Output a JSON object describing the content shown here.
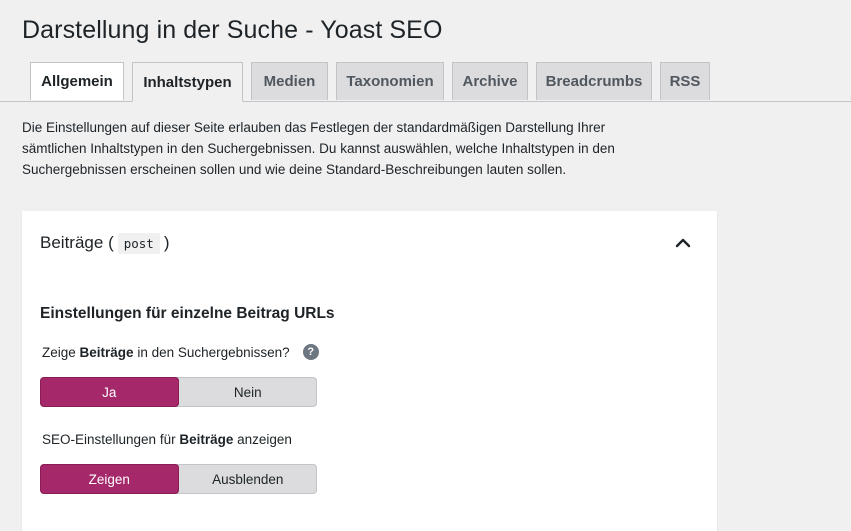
{
  "page": {
    "title": "Darstellung in der Suche - Yoast SEO"
  },
  "tabs": [
    {
      "label": "Allgemein"
    },
    {
      "label": "Inhaltstypen"
    },
    {
      "label": "Medien"
    },
    {
      "label": "Taxonomien"
    },
    {
      "label": "Archive"
    },
    {
      "label": "Breadcrumbs"
    },
    {
      "label": "RSS"
    }
  ],
  "intro": {
    "line1": "Die Einstellungen auf dieser Seite erlauben das Festlegen der standardmäßigen Darstellung Ihrer",
    "line2": "sämtlichen Inhaltstypen in den Suchergebnissen. Du kannst auswählen, welche Inhaltstypen in den",
    "line3": "Suchergebnissen erscheinen sollen und wie deine Standard-Beschreibungen lauten sollen."
  },
  "card": {
    "title": "Beiträge",
    "paren_open": "(",
    "code": "post",
    "paren_close": ")",
    "section_title": "Einstellungen für einzelne Beitrag URLs",
    "q1": {
      "prefix": "Zeige ",
      "bold": "Beiträge",
      "suffix": " in den Suchergebnissen?",
      "help": "?"
    },
    "toggle1": {
      "on": "Ja",
      "off": "Nein",
      "selected": "Ja"
    },
    "q2": {
      "prefix": "SEO-Einstellungen für ",
      "bold": "Beiträge",
      "suffix": " anzeigen"
    },
    "toggle2": {
      "on": "Zeigen",
      "off": "Ausblenden",
      "selected": "Zeigen"
    }
  },
  "colors": {
    "accent": "#a4286a",
    "background": "#f0f0f1",
    "toggle_off": "#dcdcde"
  },
  "icons": {
    "collapse": "chevron-up-icon",
    "help": "question-circle-icon"
  }
}
